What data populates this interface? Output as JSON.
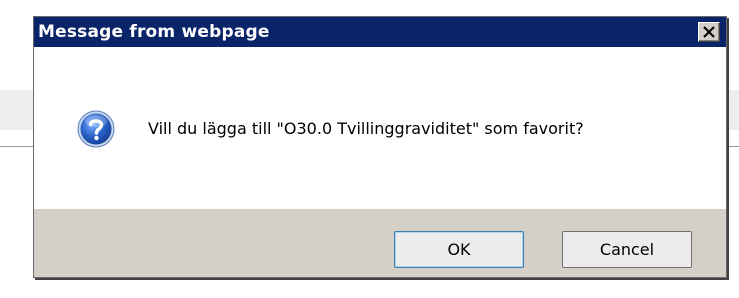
{
  "dialog": {
    "title": "Message from webpage",
    "close_symbol": "X",
    "icon": "question-icon",
    "message": "Vill du lägga till \"O30.0 Tvillinggraviditet\" som favorit?",
    "buttons": {
      "ok_label": "OK",
      "cancel_label": "Cancel"
    }
  },
  "colors": {
    "titlebar": "#0a246a",
    "dialog_face": "#d4d0c8",
    "content_bg": "#ffffff",
    "icon_blue": "#2a62c9"
  }
}
